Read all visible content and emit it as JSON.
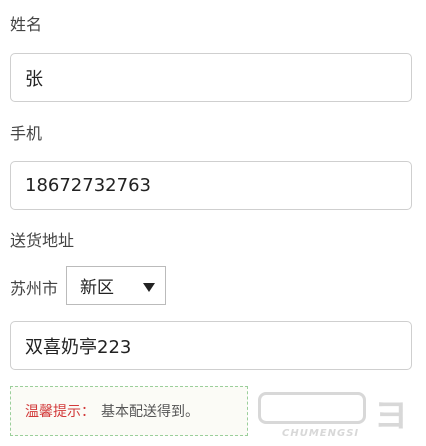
{
  "form": {
    "name_label": "姓名",
    "name_value": "张",
    "phone_label": "手机",
    "phone_value": "18672732763",
    "address_label": "送货地址",
    "city": "苏州市",
    "district_selected": "新区",
    "street_value": "双喜奶亭223"
  },
  "notice": {
    "title": "温馨提示：",
    "text": "基本配送得到。"
  },
  "watermark": {
    "text": "CHUMENGSI"
  }
}
